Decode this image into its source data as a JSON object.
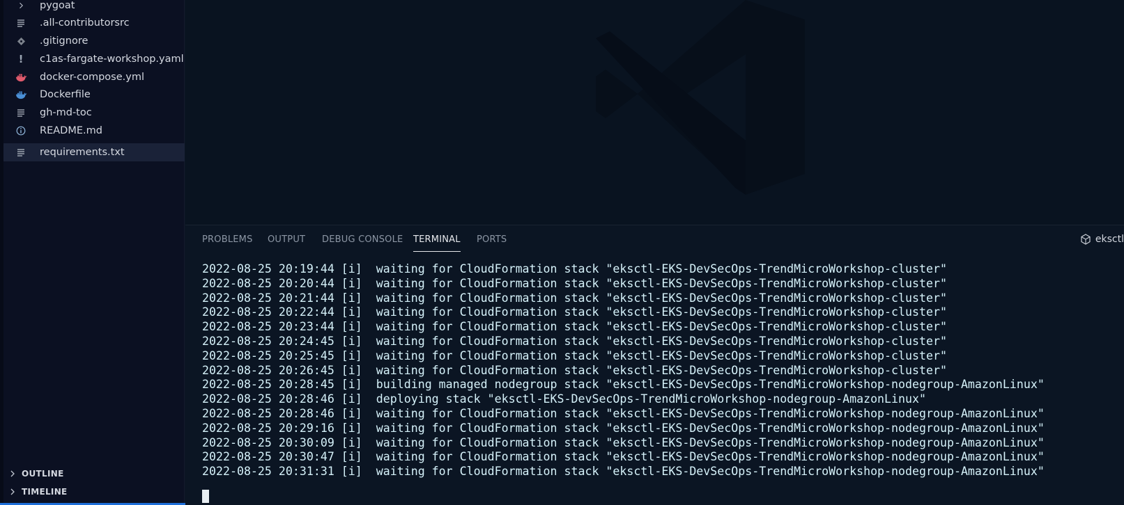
{
  "sidebar": {
    "files": [
      {
        "name": "pygoat",
        "icon": "chevron-right-icon"
      },
      {
        "name": ".all-contributorsrc",
        "icon": "text-lines-icon"
      },
      {
        "name": ".gitignore",
        "icon": "git-diamond-icon"
      },
      {
        "name": "c1as-fargate-workshop.yaml",
        "icon": "yaml-exclamation-icon"
      },
      {
        "name": "docker-compose.yml",
        "icon": "docker-whale-icon"
      },
      {
        "name": "Dockerfile",
        "icon": "docker-whale-icon"
      },
      {
        "name": "gh-md-toc",
        "icon": "text-lines-icon"
      },
      {
        "name": "README.md",
        "icon": "info-icon"
      },
      {
        "name": "requirements.txt",
        "icon": "text-lines-icon",
        "selected": true
      }
    ],
    "sections": [
      "OUTLINE",
      "TIMELINE"
    ]
  },
  "panel": {
    "tabs": [
      "PROBLEMS",
      "OUTPUT",
      "DEBUG CONSOLE",
      "TERMINAL",
      "PORTS"
    ],
    "active_tab": "TERMINAL",
    "terminal_name": "eksctl"
  },
  "terminal": {
    "lines": [
      "2022-08-25 20:19:44 [i]  waiting for CloudFormation stack \"eksctl-EKS-DevSecOps-TrendMicroWorkshop-cluster\"",
      "2022-08-25 20:20:44 [i]  waiting for CloudFormation stack \"eksctl-EKS-DevSecOps-TrendMicroWorkshop-cluster\"",
      "2022-08-25 20:21:44 [i]  waiting for CloudFormation stack \"eksctl-EKS-DevSecOps-TrendMicroWorkshop-cluster\"",
      "2022-08-25 20:22:44 [i]  waiting for CloudFormation stack \"eksctl-EKS-DevSecOps-TrendMicroWorkshop-cluster\"",
      "2022-08-25 20:23:44 [i]  waiting for CloudFormation stack \"eksctl-EKS-DevSecOps-TrendMicroWorkshop-cluster\"",
      "2022-08-25 20:24:45 [i]  waiting for CloudFormation stack \"eksctl-EKS-DevSecOps-TrendMicroWorkshop-cluster\"",
      "2022-08-25 20:25:45 [i]  waiting for CloudFormation stack \"eksctl-EKS-DevSecOps-TrendMicroWorkshop-cluster\"",
      "2022-08-25 20:26:45 [i]  waiting for CloudFormation stack \"eksctl-EKS-DevSecOps-TrendMicroWorkshop-cluster\"",
      "2022-08-25 20:28:45 [i]  building managed nodegroup stack \"eksctl-EKS-DevSecOps-TrendMicroWorkshop-nodegroup-AmazonLinux\"",
      "2022-08-25 20:28:46 [i]  deploying stack \"eksctl-EKS-DevSecOps-TrendMicroWorkshop-nodegroup-AmazonLinux\"",
      "2022-08-25 20:28:46 [i]  waiting for CloudFormation stack \"eksctl-EKS-DevSecOps-TrendMicroWorkshop-nodegroup-AmazonLinux\"",
      "2022-08-25 20:29:16 [i]  waiting for CloudFormation stack \"eksctl-EKS-DevSecOps-TrendMicroWorkshop-nodegroup-AmazonLinux\"",
      "2022-08-25 20:30:09 [i]  waiting for CloudFormation stack \"eksctl-EKS-DevSecOps-TrendMicroWorkshop-nodegroup-AmazonLinux\"",
      "2022-08-25 20:30:47 [i]  waiting for CloudFormation stack \"eksctl-EKS-DevSecOps-TrendMicroWorkshop-nodegroup-AmazonLinux\"",
      "2022-08-25 20:31:31 [i]  waiting for CloudFormation stack \"eksctl-EKS-DevSecOps-TrendMicroWorkshop-nodegroup-AmazonLinux\""
    ]
  },
  "colors": {
    "sidebar_bg": "#0b1022",
    "editor_bg": "#091320",
    "panel_bg": "#0b1523",
    "terminal_text": "#d5f1f9",
    "accent": "#1e6fd9",
    "docker_icon": "#e05a6c",
    "yaml_icon": "#c94fd1"
  }
}
